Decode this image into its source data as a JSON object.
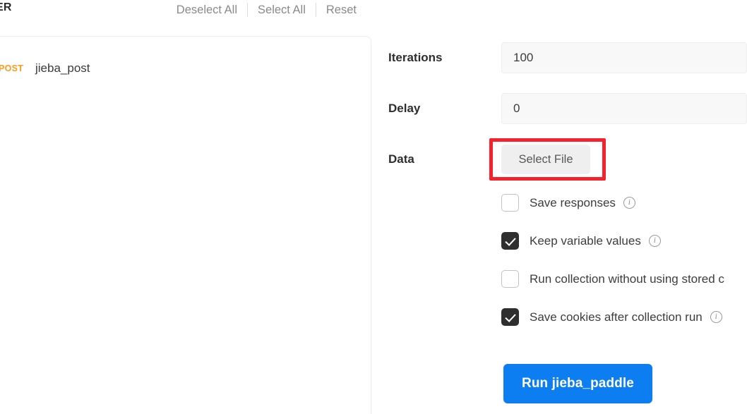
{
  "toolbar": {
    "title": "ER",
    "actions": [
      {
        "label": "Deselect All",
        "name": "deselect-all"
      },
      {
        "label": "Select All",
        "name": "select-all"
      },
      {
        "label": "Reset",
        "name": "reset"
      }
    ]
  },
  "request_list": {
    "items": [
      {
        "method": "POST",
        "name": "jieba_post"
      }
    ]
  },
  "settings": {
    "iterations": {
      "label": "Iterations",
      "value": "100"
    },
    "delay": {
      "label": "Delay",
      "value": "0"
    },
    "data": {
      "label": "Data",
      "button_label": "Select File"
    },
    "options": [
      {
        "label": "Save responses",
        "checked": false,
        "has_info": true
      },
      {
        "label": "Keep variable values",
        "checked": true,
        "has_info": true
      },
      {
        "label": "Run collection without using stored c",
        "checked": false,
        "has_info": false
      },
      {
        "label": "Save cookies after collection run",
        "checked": true,
        "has_info": true
      }
    ],
    "run_button": "Run jieba_paddle"
  },
  "colors": {
    "accent_blue": "#0c7ef2",
    "method_post": "#ff9a1a",
    "highlight_red": "#f5222d",
    "checkbox_checked": "#2f2f2f"
  }
}
